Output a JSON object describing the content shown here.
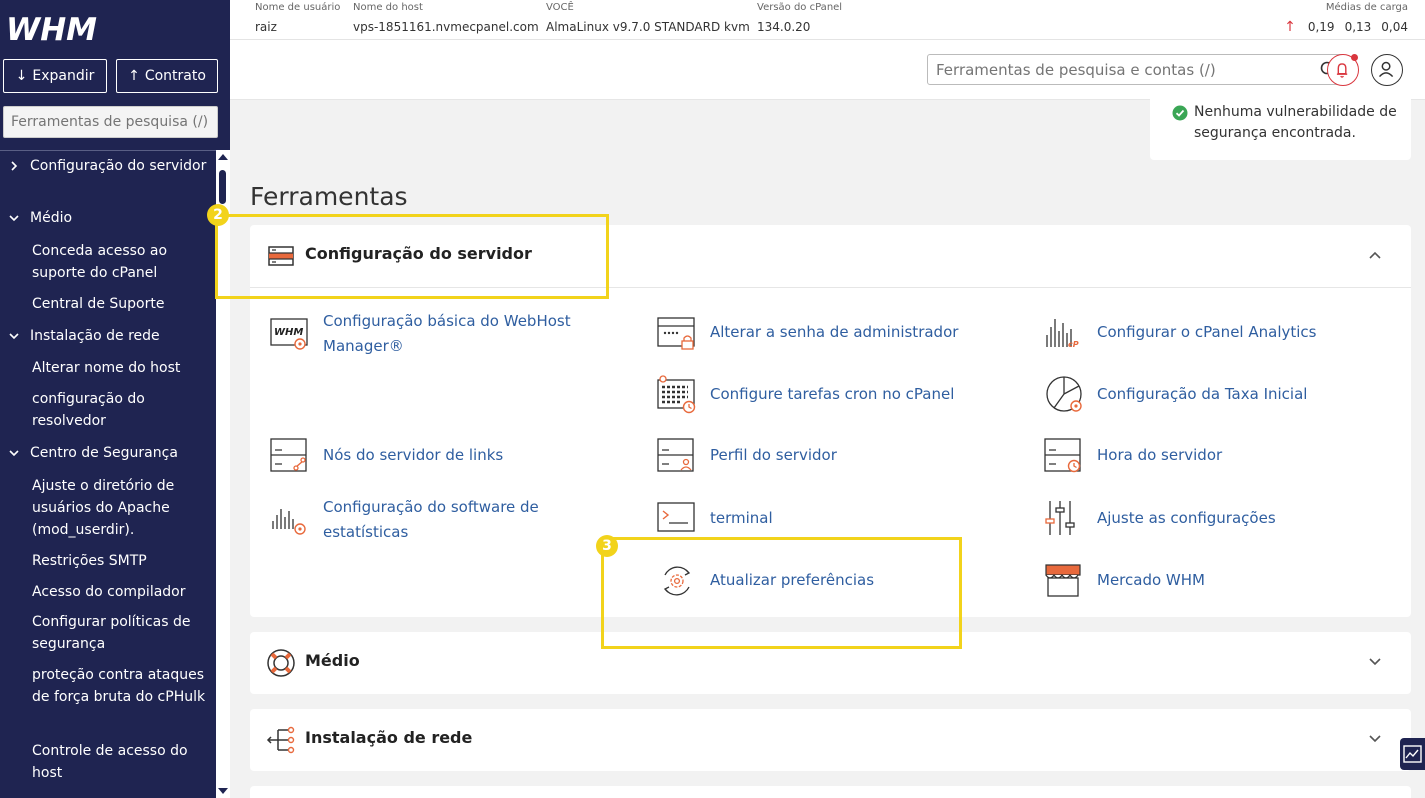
{
  "sidebar": {
    "logo_text": "WHM",
    "expand_label": "Expandir",
    "collapse_label": "Contrato",
    "search_placeholder": "Ferramentas de pesquisa (/)",
    "nav": [
      {
        "label": "Configuração do servidor",
        "type": "category",
        "expanded": false
      },
      {
        "label": "Médio",
        "type": "category",
        "expanded": true
      },
      {
        "label": "Conceda acesso ao suporte do cPanel",
        "type": "item"
      },
      {
        "label": "Central de Suporte",
        "type": "item"
      },
      {
        "label": "Instalação de rede",
        "type": "category",
        "expanded": true
      },
      {
        "label": "Alterar nome do host",
        "type": "item"
      },
      {
        "label": "configuração do resolvedor",
        "type": "item"
      },
      {
        "label": "Centro de Segurança",
        "type": "category",
        "expanded": true
      },
      {
        "label": "Ajuste o diretório de usuários do Apache (mod_userdir).",
        "type": "item"
      },
      {
        "label": "Restrições SMTP",
        "type": "item"
      },
      {
        "label": "Acesso do compilador",
        "type": "item"
      },
      {
        "label": "Configurar políticas de segurança",
        "type": "item"
      },
      {
        "label": "proteção contra ataques de força bruta do cPHulk",
        "type": "item"
      },
      {
        "label": "Controle de acesso do host",
        "type": "item"
      }
    ]
  },
  "header": {
    "info": [
      {
        "label": "Nome de usuário",
        "value": "raiz"
      },
      {
        "label": "Nome do host",
        "value": "vps-1851161.nvmecpanel.com"
      },
      {
        "label": "VOCÊ",
        "value": "AlmaLinux v9.7.0 STANDARD kvm"
      },
      {
        "label": "Versão do cPanel",
        "value": "134.0.20"
      }
    ],
    "load_label": "Médias de carga",
    "load_values": [
      "0,19",
      "0,13",
      "0,04"
    ],
    "search_placeholder": "Ferramentas de pesquisa e contas (/)"
  },
  "security_notice": "Nenhuma vulnerabilidade de segurança encontrada.",
  "tools_title": "Ferramentas",
  "sections": {
    "server_config": {
      "title": "Configuração do servidor",
      "tools": [
        "Configuração básica do WebHost Manager®",
        "Alterar a senha de administrador",
        "Configurar o cPanel Analytics",
        "Configure tarefas cron no cPanel",
        "Configuração da Taxa Inicial",
        "Nós do servidor de links",
        "Perfil do servidor",
        "Hora do servidor",
        "Configuração do software de estatísticas",
        "terminal",
        "Ajuste as configurações",
        "Atualizar preferências",
        "Mercado WHM"
      ]
    },
    "medio": {
      "title": "Médio"
    },
    "network": {
      "title": "Instalação de rede"
    }
  },
  "annotations": {
    "badge_2": "2",
    "badge_3": "3"
  },
  "colors": {
    "sidebar_bg": "#1f2451",
    "link": "#2f5ea0",
    "accent": "#e8693c",
    "highlight": "#f2d31b",
    "alert": "#d9363e",
    "success": "#3aa655"
  }
}
